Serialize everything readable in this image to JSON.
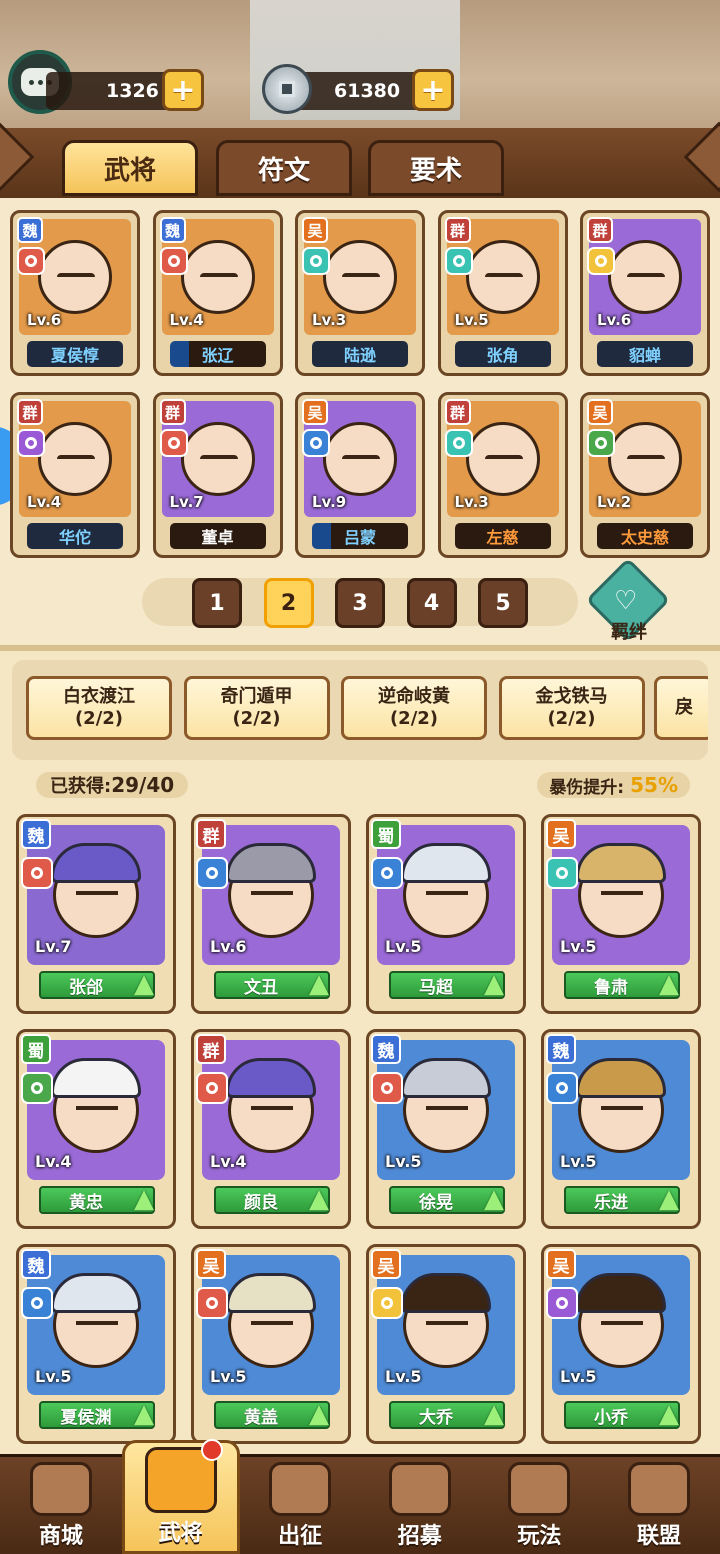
{
  "resources": {
    "gems": "1326",
    "coins": "61380"
  },
  "tabs": [
    "武将",
    "符文",
    "要术"
  ],
  "colors": {
    "wei": "#3c6fd6",
    "wu": "#e2701e",
    "qun": "#c0403a",
    "shu": "#3ea03a"
  },
  "roster": [
    {
      "faction": "魏",
      "level": "Lv.6",
      "name": "夏侯惇"
    },
    {
      "faction": "魏",
      "level": "Lv.4",
      "name": "张辽"
    },
    {
      "faction": "吴",
      "level": "Lv.3",
      "name": "陆逊"
    },
    {
      "faction": "群",
      "level": "Lv.5",
      "name": "张角"
    },
    {
      "faction": "群",
      "level": "Lv.6",
      "name": "貂蝉"
    },
    {
      "faction": "群",
      "level": "Lv.4",
      "name": "华佗"
    },
    {
      "faction": "群",
      "level": "Lv.7",
      "name": "董卓"
    },
    {
      "faction": "吴",
      "level": "Lv.9",
      "name": "吕蒙"
    },
    {
      "faction": "群",
      "level": "Lv.3",
      "name": "左慈"
    },
    {
      "faction": "吴",
      "level": "Lv.2",
      "name": "太史慈"
    }
  ],
  "pages": [
    "1",
    "2",
    "3",
    "4",
    "5"
  ],
  "current_page": "2",
  "bond_label": "羁绊",
  "bonds": [
    {
      "name": "白衣渡江",
      "progress": "(2/2)"
    },
    {
      "name": "奇门遁甲",
      "progress": "(2/2)"
    },
    {
      "name": "逆命岐黄",
      "progress": "(2/2)"
    },
    {
      "name": "金戈铁马",
      "progress": "(2/2)"
    }
  ],
  "collected_label": "已获得:",
  "collected_value": "29/40",
  "crit_label": "暴伤提升:",
  "crit_value": "55%",
  "owned": [
    {
      "faction": "魏",
      "level": "Lv.7",
      "name": "张郃"
    },
    {
      "faction": "群",
      "level": "Lv.6",
      "name": "文丑"
    },
    {
      "faction": "蜀",
      "level": "Lv.5",
      "name": "马超"
    },
    {
      "faction": "吴",
      "level": "Lv.5",
      "name": "鲁肃"
    },
    {
      "faction": "蜀",
      "level": "Lv.4",
      "name": "黄忠"
    },
    {
      "faction": "群",
      "level": "Lv.4",
      "name": "颜良"
    },
    {
      "faction": "魏",
      "level": "Lv.5",
      "name": "徐晃"
    },
    {
      "faction": "魏",
      "level": "Lv.5",
      "name": "乐进"
    },
    {
      "faction": "魏",
      "level": "Lv.5",
      "name": "夏侯渊"
    },
    {
      "faction": "吴",
      "level": "Lv.5",
      "name": "黄盖"
    },
    {
      "faction": "吴",
      "level": "Lv.5",
      "name": "大乔"
    },
    {
      "faction": "吴",
      "level": "Lv.5",
      "name": "小乔"
    }
  ],
  "nav": [
    "商城",
    "武将",
    "出征",
    "招募",
    "玩法",
    "联盟"
  ]
}
